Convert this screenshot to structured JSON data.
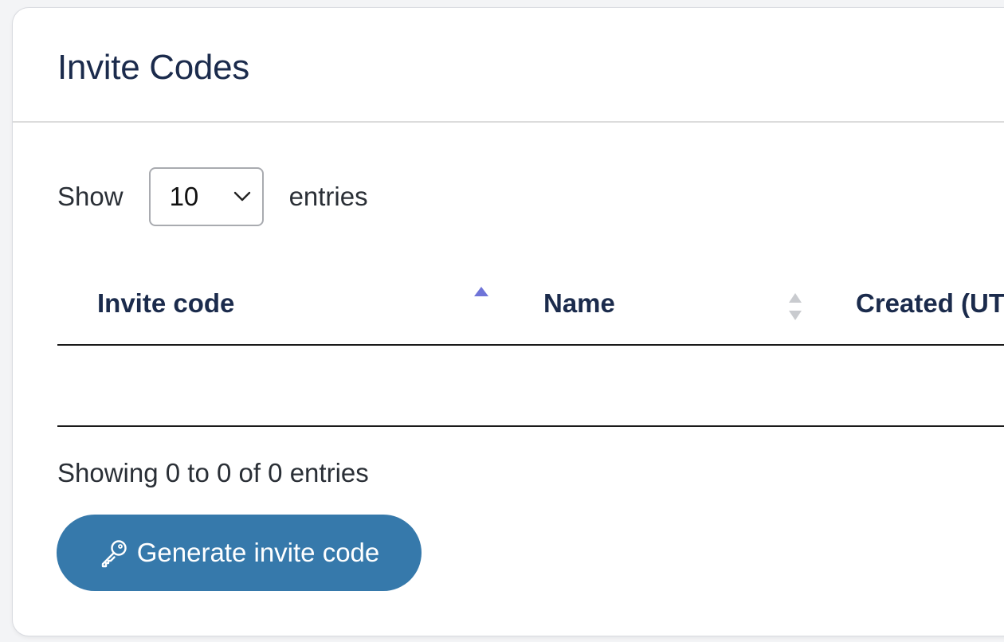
{
  "card": {
    "title": "Invite Codes"
  },
  "length_menu": {
    "prefix": "Show",
    "selected": "10",
    "suffix": "entries"
  },
  "table": {
    "columns": [
      {
        "label": "Invite code",
        "sort": "ascending"
      },
      {
        "label": "Name",
        "sort": "none"
      },
      {
        "label": "Created (UT",
        "sort": "none"
      }
    ],
    "rows": []
  },
  "info": "Showing 0 to 0 of 0 entries",
  "actions": {
    "generate_label": "Generate invite code",
    "generate_icon": "key-icon"
  },
  "colors": {
    "primary": "#3679ab",
    "heading": "#1b2b4c",
    "sort_active": "#6f74d8",
    "sort_inactive": "#c9cbcf"
  }
}
